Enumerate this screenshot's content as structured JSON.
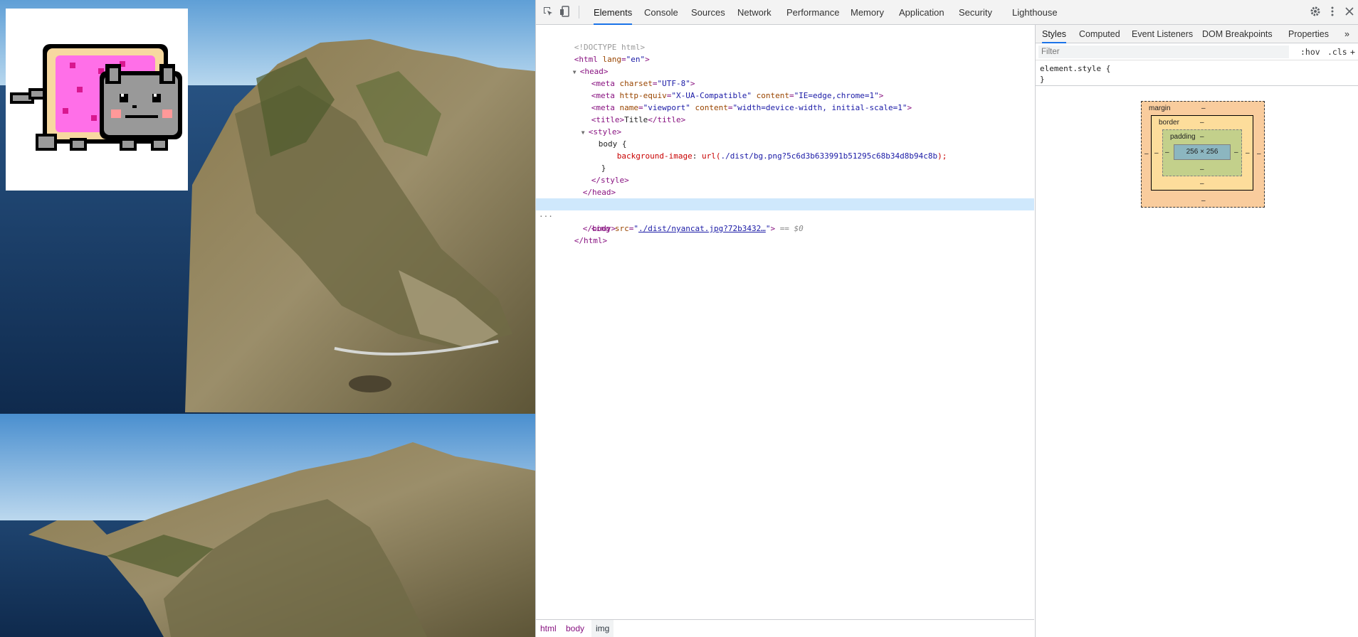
{
  "toolbar": {
    "tabs": [
      "Elements",
      "Console",
      "Sources",
      "Network",
      "Performance",
      "Memory",
      "Application",
      "Security",
      "Lighthouse"
    ],
    "active_tab": "Elements",
    "icons": [
      "inspect-element-icon",
      "device-toolbar-icon",
      "settings-icon",
      "more-options-icon",
      "close-icon"
    ]
  },
  "dom": {
    "doctype": "<!DOCTYPE html>",
    "html_open_tag": "html",
    "html_lang_attr": "lang",
    "html_lang_val": "\"en\"",
    "head_tag": "head",
    "meta1_attr": "charset",
    "meta1_val": "\"UTF-8\"",
    "meta2_attr1": "http-equiv",
    "meta2_val1": "\"X-UA-Compatible\"",
    "meta2_attr2": "content",
    "meta2_val2": "\"IE=edge,chrome=1\"",
    "meta3_attr1": "name",
    "meta3_val1": "\"viewport\"",
    "meta3_attr2": "content",
    "meta3_val2": "\"width=device-width, initial-scale=1\"",
    "title_text": "Title",
    "style_tag": "style",
    "css_selector": "body {",
    "css_prop": "background-image",
    "css_url_prefix": "url(",
    "css_url": "./dist/bg.png?5c6d3b633991b51295c68b34d8b94c8b",
    "css_url_suffix": ");",
    "css_close": "}",
    "body_tag": "body",
    "img_attr": "src",
    "img_src": "./dist/nyancat.jpg?72b3432…",
    "selected_marker": "== $0"
  },
  "breadcrumb": [
    "html",
    "body",
    "img"
  ],
  "sidebar": {
    "tabs": [
      "Styles",
      "Computed",
      "Event Listeners",
      "DOM Breakpoints",
      "Properties"
    ],
    "active_tab": "Styles",
    "more_tabs": "»",
    "filter_placeholder": "Filter",
    "hov_label": ":hov",
    "cls_label": ".cls",
    "add_label": "+",
    "element_style_open": "element.style {",
    "element_style_close": "}"
  },
  "box_model": {
    "margin_label": "margin",
    "border_label": "border",
    "padding_label": "padding",
    "content_size": "256 × 256",
    "dash": "–"
  },
  "colors": {
    "accent": "#1a73e8",
    "selected_row": "#cfe8fc",
    "tag": "#881280",
    "attr_name": "#994500",
    "attr_value": "#1a1aa6"
  }
}
